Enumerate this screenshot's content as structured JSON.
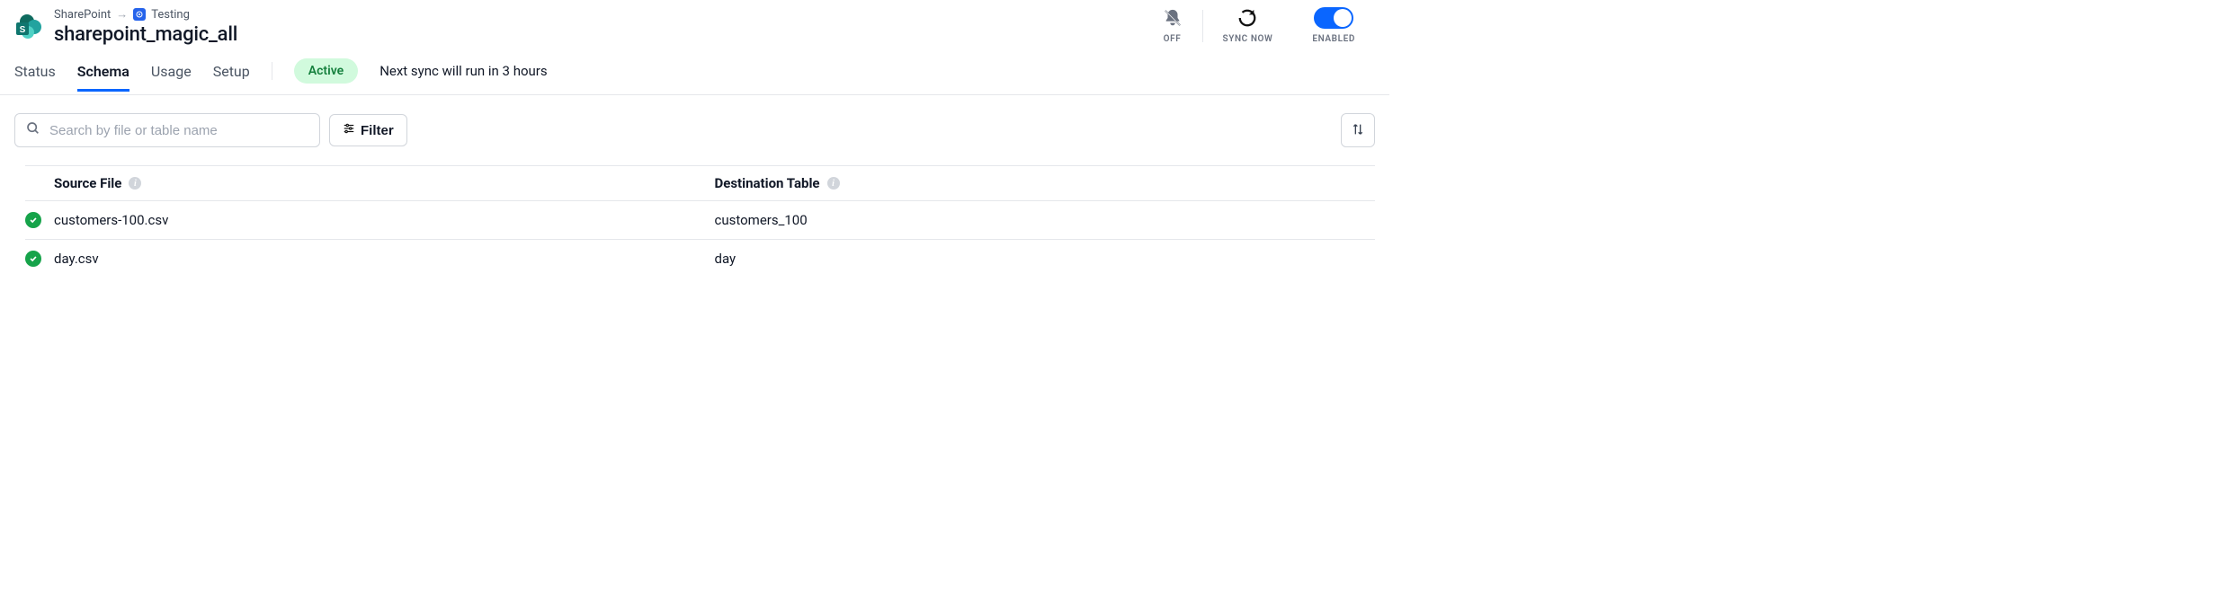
{
  "breadcrumb": {
    "connector": "SharePoint",
    "workspace": "Testing"
  },
  "page_title": "sharepoint_magic_all",
  "header_actions": {
    "off": "OFF",
    "sync_now": "SYNC NOW",
    "enabled": "ENABLED"
  },
  "tabs": {
    "status": "Status",
    "schema": "Schema",
    "usage": "Usage",
    "setup": "Setup"
  },
  "status": {
    "pill": "Active",
    "next_sync": "Next sync will run in 3 hours"
  },
  "toolbar": {
    "search_placeholder": "Search by file or table name",
    "filter_label": "Filter"
  },
  "table": {
    "col_source": "Source File",
    "col_dest": "Destination Table",
    "rows": [
      {
        "source": "customers-100.csv",
        "dest": "customers_100"
      },
      {
        "source": "day.csv",
        "dest": "day"
      }
    ]
  }
}
